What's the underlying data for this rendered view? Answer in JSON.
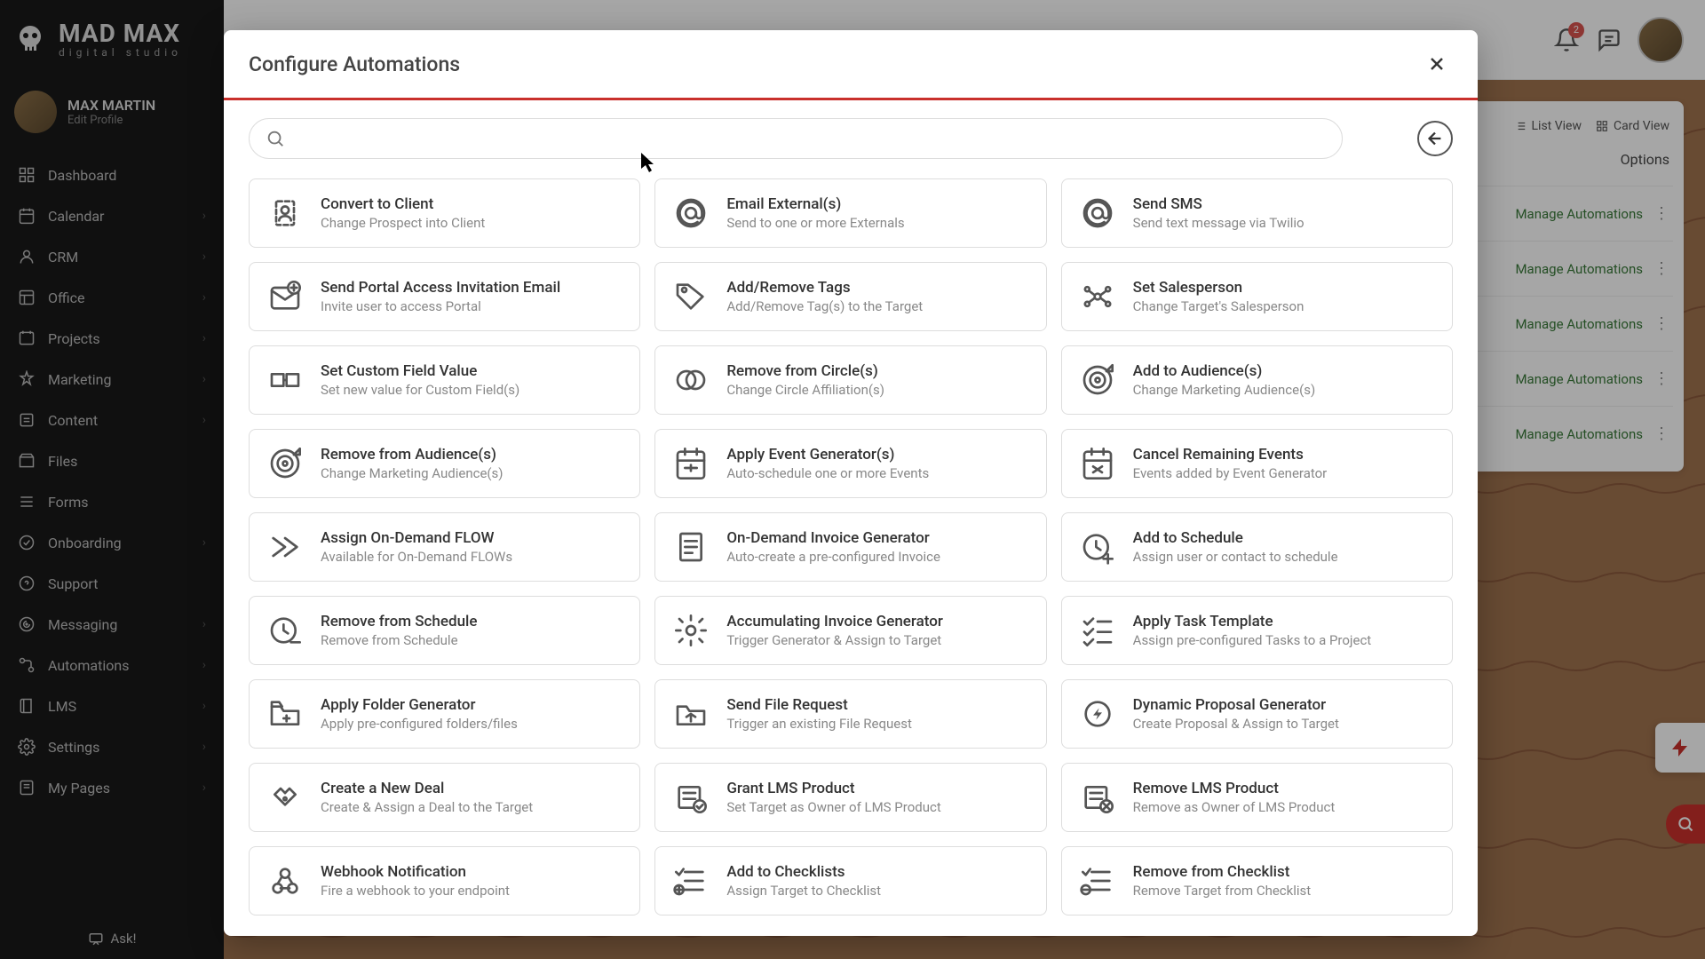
{
  "logo": {
    "main": "MAD MAX",
    "sub": "digital studio"
  },
  "profile": {
    "name": "MAX MARTIN",
    "edit": "Edit Profile"
  },
  "nav": [
    {
      "label": "Dashboard",
      "icon": "dashboard",
      "expandable": false
    },
    {
      "label": "Calendar",
      "icon": "calendar",
      "expandable": true
    },
    {
      "label": "CRM",
      "icon": "crm",
      "expandable": true
    },
    {
      "label": "Office",
      "icon": "office",
      "expandable": true
    },
    {
      "label": "Projects",
      "icon": "projects",
      "expandable": true
    },
    {
      "label": "Marketing",
      "icon": "marketing",
      "expandable": true
    },
    {
      "label": "Content",
      "icon": "content",
      "expandable": true
    },
    {
      "label": "Files",
      "icon": "files",
      "expandable": false
    },
    {
      "label": "Forms",
      "icon": "forms",
      "expandable": false
    },
    {
      "label": "Onboarding",
      "icon": "onboarding",
      "expandable": true
    },
    {
      "label": "Support",
      "icon": "support",
      "expandable": false
    },
    {
      "label": "Messaging",
      "icon": "messaging",
      "expandable": true
    },
    {
      "label": "Automations",
      "icon": "automations",
      "expandable": true
    },
    {
      "label": "LMS",
      "icon": "lms",
      "expandable": true
    },
    {
      "label": "Settings",
      "icon": "settings",
      "expandable": true
    },
    {
      "label": "My Pages",
      "icon": "mypages",
      "expandable": true
    }
  ],
  "ask": "Ask!",
  "topbar": {
    "badge": "2"
  },
  "bg": {
    "list_view": "List View",
    "card_view": "Card View",
    "options": "Options",
    "manage": "Manage Automations"
  },
  "modal": {
    "title": "Configure Automations",
    "search_placeholder": "",
    "cards": [
      {
        "title": "Convert to Client",
        "sub": "Change Prospect into Client",
        "icon": "convert"
      },
      {
        "title": "Email External(s)",
        "sub": "Send to one or more Externals",
        "icon": "at"
      },
      {
        "title": "Send SMS",
        "sub": "Send text message via Twilio",
        "icon": "at"
      },
      {
        "title": "Send Portal Access Invitation Email",
        "sub": "Invite user to access Portal",
        "icon": "mailplus"
      },
      {
        "title": "Add/Remove Tags",
        "sub": "Add/Remove Tag(s) to the Target",
        "icon": "tag"
      },
      {
        "title": "Set Salesperson",
        "sub": "Change Target's Salesperson",
        "icon": "network"
      },
      {
        "title": "Set Custom Field Value",
        "sub": "Set new value for Custom Field(s)",
        "icon": "customfield"
      },
      {
        "title": "Remove from Circle(s)",
        "sub": "Change Circle Affiliation(s)",
        "icon": "circles"
      },
      {
        "title": "Add to Audience(s)",
        "sub": "Change Marketing Audience(s)",
        "icon": "target"
      },
      {
        "title": "Remove from Audience(s)",
        "sub": "Change Marketing Audience(s)",
        "icon": "target"
      },
      {
        "title": "Apply Event Generator(s)",
        "sub": "Auto-schedule one or more Events",
        "icon": "calgen"
      },
      {
        "title": "Cancel Remaining Events",
        "sub": "Events added by Event Generator",
        "icon": "calx"
      },
      {
        "title": "Assign On-Demand FLOW",
        "sub": "Available for On-Demand FLOWs",
        "icon": "flow"
      },
      {
        "title": "On-Demand Invoice Generator",
        "sub": "Auto-create a pre-configured Invoice",
        "icon": "invoice"
      },
      {
        "title": "Add to Schedule",
        "sub": "Assign user or contact to schedule",
        "icon": "clockplus"
      },
      {
        "title": "Remove from Schedule",
        "sub": "Remove from Schedule",
        "icon": "clockminus"
      },
      {
        "title": "Accumulating Invoice Generator",
        "sub": "Trigger Generator & Assign to Target",
        "icon": "geargen"
      },
      {
        "title": "Apply Task Template",
        "sub": "Assign pre-configured Tasks to a Project",
        "icon": "checklist"
      },
      {
        "title": "Apply Folder Generator",
        "sub": "Apply pre-configured folders/files",
        "icon": "foldergen"
      },
      {
        "title": "Send File Request",
        "sub": "Trigger an existing File Request",
        "icon": "folderup"
      },
      {
        "title": "Dynamic Proposal Generator",
        "sub": "Create Proposal & Assign to Target",
        "icon": "gearbolt"
      },
      {
        "title": "Create a New Deal",
        "sub": "Create & Assign a Deal to the Target",
        "icon": "handshake"
      },
      {
        "title": "Grant LMS Product",
        "sub": "Set Target as Owner of LMS Product",
        "icon": "lmsgrant"
      },
      {
        "title": "Remove LMS Product",
        "sub": "Remove as Owner of LMS Product",
        "icon": "lmsremove"
      },
      {
        "title": "Webhook Notification",
        "sub": "Fire a webhook to your endpoint",
        "icon": "webhook"
      },
      {
        "title": "Add to Checklists",
        "sub": "Assign Target to Checklist",
        "icon": "checkadd"
      },
      {
        "title": "Remove from Checklist",
        "sub": "Remove Target from Checklist",
        "icon": "checkremove"
      }
    ]
  }
}
